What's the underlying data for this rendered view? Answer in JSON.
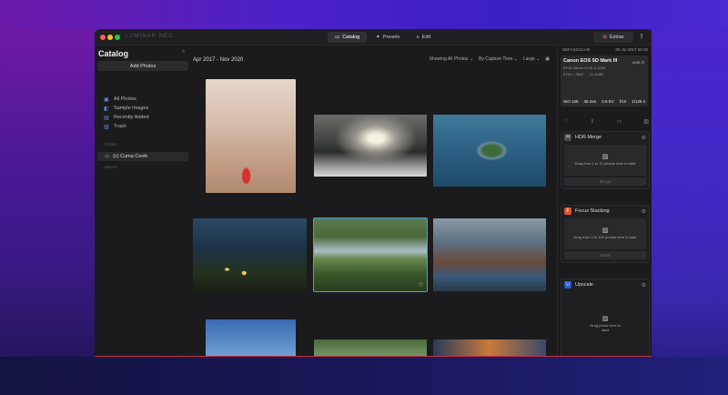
{
  "window": {
    "brand": "LUMINAR NEO"
  },
  "topnav": {
    "tabs": [
      {
        "label": "Catalog",
        "icon": "folder-icon"
      },
      {
        "label": "Presets",
        "icon": "magic-icon"
      },
      {
        "label": "Edit",
        "icon": "sliders-icon"
      }
    ],
    "extras_label": "Extras"
  },
  "sidebar": {
    "title": "Catalog",
    "add_photos_label": "Add Photos",
    "items": [
      {
        "label": "All Photos",
        "icon": "photos-icon"
      },
      {
        "label": "Sample Images",
        "icon": "sample-icon"
      },
      {
        "label": "Recently Added",
        "icon": "recent-icon"
      },
      {
        "label": "Trash",
        "icon": "trash-icon"
      }
    ],
    "folders_section": "Folders",
    "folder": "(c) Cuma Cevik",
    "albums_section": "Albums"
  },
  "main": {
    "date_range": "Apr 2017 - Nov 2020",
    "filter_show": "Showing All Photos",
    "filter_sort": "By Capture Time",
    "filter_size": "Large"
  },
  "rpanel": {
    "file_label": "SEFASO12.HE",
    "date_label": "30 Jul 2017 06:00",
    "camera": "Canon EOS 5D Mark III",
    "lens": "EF16-35mm f/2.8L II USM",
    "dims": "5760 × 3840",
    "size": "21.8 MB",
    "badges": "AWB",
    "iso": "ISO 125",
    "focal": "35 mm",
    "ev": "0.6 EV",
    "fstop": "f/10",
    "shutter": "1/125 s",
    "tools": [
      {
        "title": "HDR Merge",
        "body": "Drag from 1 to 10 photos here to start",
        "button": "Merge",
        "color": "#4a4a4e",
        "glyph": "H"
      },
      {
        "title": "Focus Stacking",
        "body": "Drag from 2 to 100 photos here to start",
        "button": "Stack",
        "color": "#e0552a",
        "glyph": "F"
      },
      {
        "title": "Upscale",
        "body": "Drag photo here to start",
        "button": "",
        "color": "#2a5bd0",
        "glyph": "U"
      }
    ]
  }
}
